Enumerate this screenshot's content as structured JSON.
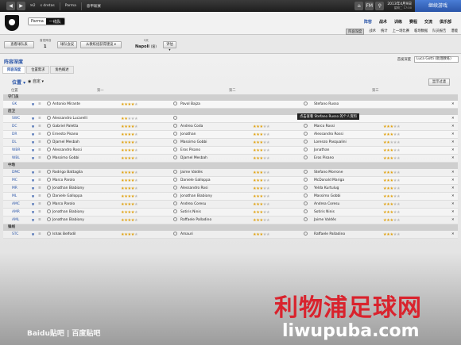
{
  "topbar": {
    "inbox_count": "2",
    "manager": "s dretas",
    "club": "Parma",
    "breadcrumb": "意甲联赛",
    "fm_label": "FM",
    "date": "2013年4月9日",
    "weekday": "星期二 17:00",
    "continue_label": "继续游戏"
  },
  "header": {
    "club_name": "Parma",
    "team_label": "一线队",
    "nav": [
      "阵容",
      "战术",
      "训练",
      "赛程",
      "交流",
      "俱乐部"
    ],
    "subnav": [
      "阵容深度",
      "战术",
      "统计",
      "上一场比赛",
      "临场数据",
      "队员报告",
      "潜能"
    ]
  },
  "toolbar": {
    "team_select": "查看球队表",
    "squad_num_label": "首发阵容",
    "squad_num": "1",
    "select_club": "球队会议",
    "from_squad": "从教练组获得建议",
    "opponent_label": "5天",
    "opponent": "Napoli",
    "opponent_venue": "(客)",
    "eval": "评估"
  },
  "content": {
    "title": "阵容深度",
    "subtabs": [
      "阵容深度",
      "位置需求",
      "角色概述"
    ],
    "depth_label": "首发深度",
    "depth_coach": "Luca Gotti (助理教练)",
    "pos_label": "位置",
    "view_label": "自定",
    "show_filter": "显示过滤",
    "col_pos": "位置",
    "col_1": "第一",
    "col_2": "第二",
    "col_3": "第三",
    "tooltip": "点击查看 Stefano Russo 的个人资料"
  },
  "groups": [
    {
      "name": "守门员",
      "rows": [
        {
          "pos": "GK",
          "p1": "Antonio Mirante",
          "s1": 4,
          "p2": "Pavol Bajza",
          "s2": 0,
          "p3": "Stefano Russo",
          "s3": 0
        }
      ]
    },
    {
      "name": "后卫",
      "rows": [
        {
          "pos": "SWC",
          "p1": "Alessandro Lucarelli",
          "s1": 2,
          "p2": "",
          "s2": 0,
          "p3": "",
          "s3": 0
        },
        {
          "pos": "DC",
          "p1": "Gabriel Paletta",
          "s1": 4,
          "p2": "Andrea Coda",
          "s2": 3,
          "p3": "Marco Rossi",
          "s3": 3
        },
        {
          "pos": "DR",
          "p1": "Ernesto Pisano",
          "s1": 4,
          "p2": "Jonathan",
          "s2": 3,
          "p3": "Alessandro Rossi",
          "s3": 3
        },
        {
          "pos": "DL",
          "p1": "Djamel Mesbah",
          "s1": 4,
          "p2": "Massimo Gobbi",
          "s2": 3,
          "p3": "Lorenzo Pasqualini",
          "s3": 2
        },
        {
          "pos": "WBR",
          "p1": "Alessandro Rossi",
          "s1": 4,
          "p2": "Eros Pisano",
          "s2": 3,
          "p3": "Jonathan",
          "s3": 3
        },
        {
          "pos": "WBL",
          "p1": "Massimo Gobbi",
          "s1": 4,
          "p2": "Djamel Mesbah",
          "s2": 3,
          "p3": "Eros Pisano",
          "s3": 3
        }
      ]
    },
    {
      "name": "中场",
      "rows": [
        {
          "pos": "DMC",
          "p1": "Rodrigo Battaglia",
          "s1": 4,
          "p2": "Jaime Valdés",
          "s2": 3,
          "p3": "Stefano Morrone",
          "s3": 3
        },
        {
          "pos": "MC",
          "p1": "Marco Parolo",
          "s1": 4,
          "p2": "Daniele Galloppa",
          "s2": 3,
          "p3": "McDonald Mariga",
          "s3": 3
        },
        {
          "pos": "MR",
          "p1": "Jonathan Biabiany",
          "s1": 4,
          "p2": "Alessandro Rosi",
          "s2": 3,
          "p3": "Yelda Kurtulug",
          "s3": 3
        },
        {
          "pos": "ML",
          "p1": "Daniele Galloppa",
          "s1": 4,
          "p2": "Jonathan Biabiany",
          "s2": 3,
          "p3": "Massimo Gobbi",
          "s3": 3
        },
        {
          "pos": "AMC",
          "p1": "Marco Parolo",
          "s1": 4,
          "p2": "Andrea Coresu",
          "s2": 3,
          "p3": "Andrea Coresu",
          "s3": 3
        },
        {
          "pos": "AMR",
          "p1": "Jonathan Biabiany",
          "s1": 4,
          "p2": "Sotiris Ninis",
          "s2": 3,
          "p3": "Sotiris Ninis",
          "s3": 3
        },
        {
          "pos": "AML",
          "p1": "Jonathan Biabiany",
          "s1": 4,
          "p2": "Raffaele Palladino",
          "s2": 3,
          "p3": "Jaime Valdés",
          "s3": 3
        }
      ]
    },
    {
      "name": "锋线",
      "rows": [
        {
          "pos": "STC",
          "p1": "Ishak Belfodil",
          "s1": 4,
          "p2": "Amauri",
          "s2": 3,
          "p3": "Raffaele Palladino",
          "s3": 3
        }
      ]
    }
  ],
  "watermarks": {
    "left": "Baidu贴吧 | 百度贴吧",
    "logo": "利物浦足球网",
    "url": "liwupuba.com"
  },
  "colors": {
    "accent": "#2a55a8",
    "star": "#e0a10f",
    "continue": "#3a6bc8"
  }
}
